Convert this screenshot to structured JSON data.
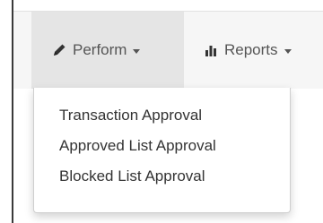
{
  "navbar": {
    "items": [
      {
        "label": "Perform",
        "icon": "pencil-icon",
        "active": true
      },
      {
        "label": "Reports",
        "icon": "bar-chart-icon",
        "active": false
      }
    ]
  },
  "dropdown": {
    "items": [
      {
        "label": "Transaction Approval"
      },
      {
        "label": "Approved List Approval"
      },
      {
        "label": "Blocked List Approval"
      }
    ]
  },
  "colors": {
    "navbar_bg": "#f6f6f6",
    "active_bg": "#e5e5e5",
    "nav_text": "#555555",
    "menu_text": "#333333"
  }
}
